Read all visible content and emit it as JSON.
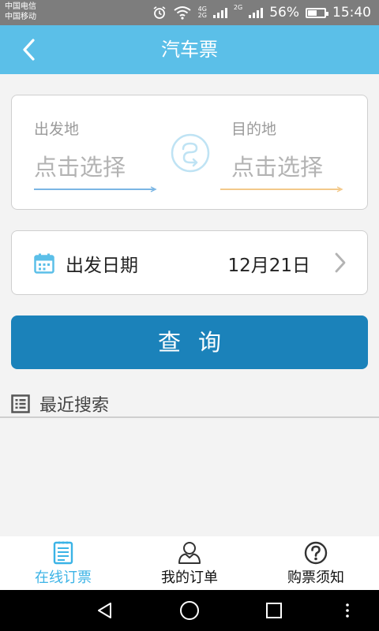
{
  "status": {
    "carrier1": "中国电信",
    "carrier2": "中国移动",
    "net1": "4G",
    "net2": "2G",
    "net3": "2G",
    "battery": "56%",
    "battery_level": 0.56,
    "time": "15:40"
  },
  "header": {
    "title": "汽车票"
  },
  "route": {
    "origin": {
      "label": "出发地",
      "value": "点击选择"
    },
    "destination": {
      "label": "目的地",
      "value": "点击选择"
    }
  },
  "date": {
    "label": "出发日期",
    "value": "12月21日"
  },
  "query": {
    "label": "查询"
  },
  "recent": {
    "label": "最近搜索"
  },
  "tabs": [
    {
      "label": "在线订票",
      "icon": "ticket-list-icon",
      "active": true
    },
    {
      "label": "我的订单",
      "icon": "user-icon",
      "active": false
    },
    {
      "label": "购票须知",
      "icon": "question-icon",
      "active": false
    }
  ],
  "colors": {
    "header": "#5bbfe8",
    "button": "#1b82ba",
    "active_tab": "#3bb3e6",
    "origin_line": "#7bb6e4",
    "destination_line": "#f3c98a"
  }
}
